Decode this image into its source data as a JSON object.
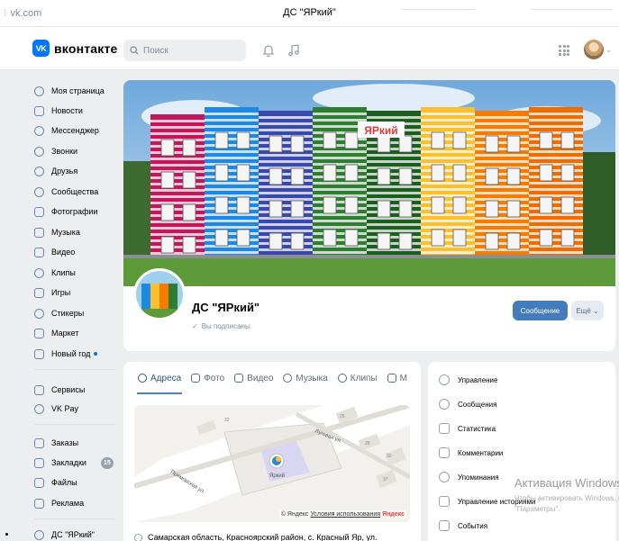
{
  "browser": {
    "url": "vk.com",
    "tab_title": "ДС \"ЯРкий\""
  },
  "header": {
    "logo_mark": "VK",
    "logo_text": "вконтакте",
    "search_placeholder": "Поиск",
    "icons": [
      "bell-icon",
      "music-icon",
      "apps-icon"
    ]
  },
  "sidebar": {
    "items": [
      {
        "label": "Моя страница",
        "icon": "user-icon"
      },
      {
        "label": "Новости",
        "icon": "news-icon"
      },
      {
        "label": "Мессенджер",
        "icon": "message-icon"
      },
      {
        "label": "Звонки",
        "icon": "phone-icon"
      },
      {
        "label": "Друзья",
        "icon": "friends-icon"
      },
      {
        "label": "Сообщества",
        "icon": "groups-icon"
      },
      {
        "label": "Фотографии",
        "icon": "photo-icon"
      },
      {
        "label": "Музыка",
        "icon": "music-icon"
      },
      {
        "label": "Видео",
        "icon": "video-icon"
      },
      {
        "label": "Клипы",
        "icon": "clips-icon"
      },
      {
        "label": "Игры",
        "icon": "games-icon"
      },
      {
        "label": "Стикеры",
        "icon": "sticker-icon"
      },
      {
        "label": "Маркет",
        "icon": "market-icon"
      },
      {
        "label": "Новый год",
        "icon": "gift-icon"
      }
    ],
    "items2": [
      {
        "label": "Сервисы",
        "icon": "services-icon"
      },
      {
        "label": "VK Pay",
        "icon": "vkpay-icon"
      }
    ],
    "items3": [
      {
        "label": "Заказы",
        "icon": "orders-icon"
      },
      {
        "label": "Закладки",
        "icon": "bookmark-icon",
        "badge": "15"
      },
      {
        "label": "Файлы",
        "icon": "file-icon"
      },
      {
        "label": "Реклама",
        "icon": "ads-icon"
      }
    ],
    "items4": [
      {
        "label": "ДС \"ЯРкий\"",
        "icon": "groups-icon"
      }
    ]
  },
  "cover": {
    "sign_text": "ЯРкий",
    "colors": [
      "#c2185b",
      "#1e88e5",
      "#3949ab",
      "#2e7d32",
      "#1b5e20",
      "#fbc02d",
      "#f57c00",
      "#ef6c00"
    ]
  },
  "profile": {
    "name": "ДС \"ЯРкий\"",
    "subscribed": "Вы подписаны",
    "message_button": "Сообщение",
    "more_button": "Ещё"
  },
  "tabs": [
    {
      "label": "Адреса",
      "active": true
    },
    {
      "label": "Фото",
      "active": false
    },
    {
      "label": "Видео",
      "active": false
    },
    {
      "label": "Музыка",
      "active": false
    },
    {
      "label": "Клипы",
      "active": false
    },
    {
      "label": "М",
      "active": false
    }
  ],
  "map": {
    "labels": {
      "street1": "Луговая ул.",
      "street2": "Приморская ул.",
      "place": "Яркий",
      "n1": "32",
      "n2": "26",
      "n3": "28",
      "n4": "30",
      "n5": "37"
    },
    "copyright": "© Яндекс",
    "terms_link": "Условия использования",
    "yandex": "Яндекс"
  },
  "address_text": "Самарская область, Красноярский район, с. Красный Яр, ул.",
  "right_menu": [
    {
      "label": "Управление",
      "icon": "gear-icon"
    },
    {
      "label": "Сообщения",
      "icon": "message-icon"
    },
    {
      "label": "Статистика",
      "icon": "stats-icon"
    },
    {
      "label": "Комментарии",
      "icon": "comment-icon"
    },
    {
      "label": "Упоминания",
      "icon": "at-icon"
    },
    {
      "label": "Управление историями",
      "icon": "stories-icon"
    },
    {
      "label": "События",
      "icon": "event-icon"
    }
  ],
  "watermark": {
    "title": "Активация Windows",
    "line1": "Чтобы активировать Windows, перейдите в раздел",
    "line2": "\"Параметры\"."
  }
}
